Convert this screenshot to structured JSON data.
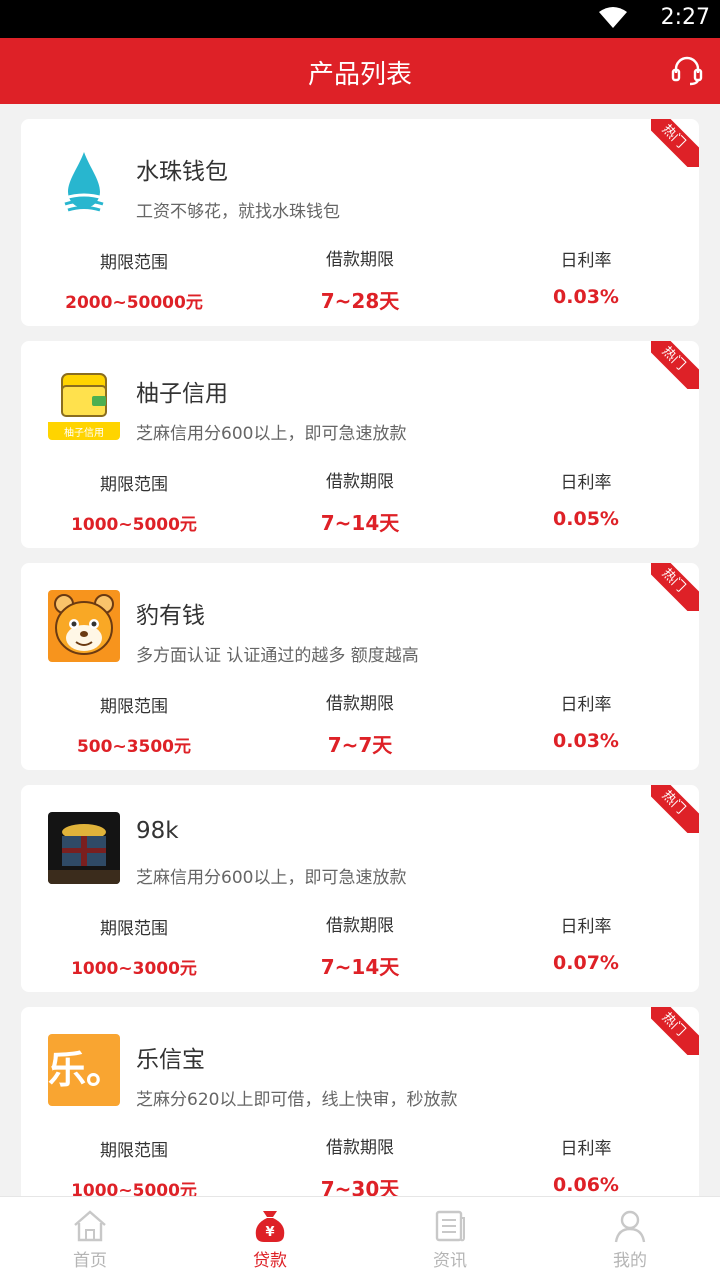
{
  "status_bar": {
    "time": "2:27"
  },
  "header": {
    "title": "产品列表"
  },
  "products": [
    {
      "name": "水珠钱包",
      "desc": "工资不够花，就找水珠钱包",
      "range_label": "期限范围",
      "range": "2000~50000元",
      "term_label": "借款期限",
      "term": "7~28天",
      "rate_label": "日利率",
      "rate": "0.03%",
      "badge": "热门"
    },
    {
      "name": "柚子信用",
      "logo_text": "柚子信用",
      "desc": "芝麻信用分600以上，即可急速放款",
      "range_label": "期限范围",
      "range": "1000~5000元",
      "term_label": "借款期限",
      "term": "7~14天",
      "rate_label": "日利率",
      "rate": "0.05%",
      "badge": "热门"
    },
    {
      "name": "豹有钱",
      "desc": "多方面认证 认证通过的越多 额度越高",
      "range_label": "期限范围",
      "range": "500~3500元",
      "term_label": "借款期限",
      "term": "7~7天",
      "rate_label": "日利率",
      "rate": "0.03%",
      "badge": "热门"
    },
    {
      "name": "98k",
      "desc": "芝麻信用分600以上，即可急速放款",
      "range_label": "期限范围",
      "range": "1000~3000元",
      "term_label": "借款期限",
      "term": "7~14天",
      "rate_label": "日利率",
      "rate": "0.07%",
      "badge": "热门"
    },
    {
      "name": "乐信宝",
      "logo_text": "乐。",
      "desc": "芝麻分620以上即可借，线上快审，秒放款",
      "range_label": "期限范围",
      "range": "1000~5000元",
      "term_label": "借款期限",
      "term": "7~30天",
      "rate_label": "日利率",
      "rate": "0.06%",
      "badge": "热门"
    }
  ],
  "tabs": [
    {
      "label": "首页",
      "icon": "home-icon",
      "active": false
    },
    {
      "label": "贷款",
      "icon": "money-bag-icon",
      "active": true
    },
    {
      "label": "资讯",
      "icon": "news-icon",
      "active": false
    },
    {
      "label": "我的",
      "icon": "profile-icon",
      "active": false
    }
  ],
  "colors": {
    "brand": "#de2127",
    "inactive": "#b5b5b5",
    "background": "#f2f2f2"
  }
}
